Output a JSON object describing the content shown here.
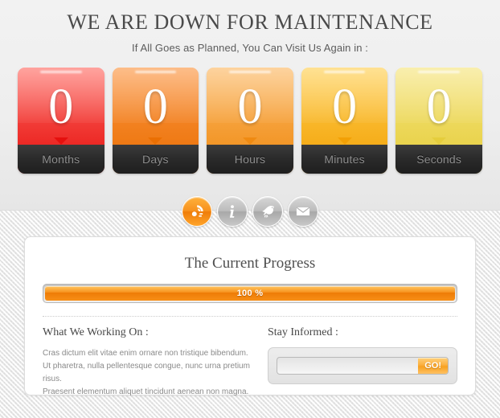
{
  "header": {
    "title": "WE ARE DOWN FOR MAINTENANCE",
    "subtitle": "If All Goes as Planned, You Can Visit Us Again in :"
  },
  "countdown": {
    "units": [
      {
        "value": "0",
        "label": "Months",
        "color_top": "#ff6b63",
        "color_bottom": "#e5100e"
      },
      {
        "value": "0",
        "label": "Days",
        "color_top": "#fb9541",
        "color_bottom": "#ea6f03"
      },
      {
        "value": "0",
        "label": "Hours",
        "color_top": "#fcb863",
        "color_bottom": "#ef8a12"
      },
      {
        "value": "0",
        "label": "Minutes",
        "color_top": "#ffcf50",
        "color_bottom": "#f2a005"
      },
      {
        "value": "0",
        "label": "Seconds",
        "color_top": "#f5e47c",
        "color_bottom": "#e5cd3c"
      }
    ]
  },
  "social": {
    "icons": [
      {
        "name": "rss-refresh-icon",
        "accent": true
      },
      {
        "name": "info-icon",
        "accent": false
      },
      {
        "name": "twitter-bird-icon",
        "accent": false
      },
      {
        "name": "envelope-icon",
        "accent": false
      }
    ]
  },
  "panel": {
    "title": "The Current Progress",
    "progress": {
      "percent": 100,
      "label": "100 %"
    },
    "working_on": {
      "heading": "What We Working On :",
      "lines": [
        "Cras dictum elit vitae enim ornare non tristique bibendum.",
        "Ut pharetra, nulla pellentesque congue, nunc urna pretium risus.",
        "Praesent elementum aliquet tincidunt aenean non magna."
      ]
    },
    "subscribe": {
      "heading": "Stay Informed :",
      "input_value": "",
      "input_placeholder": "",
      "button_label": "GO!"
    }
  }
}
